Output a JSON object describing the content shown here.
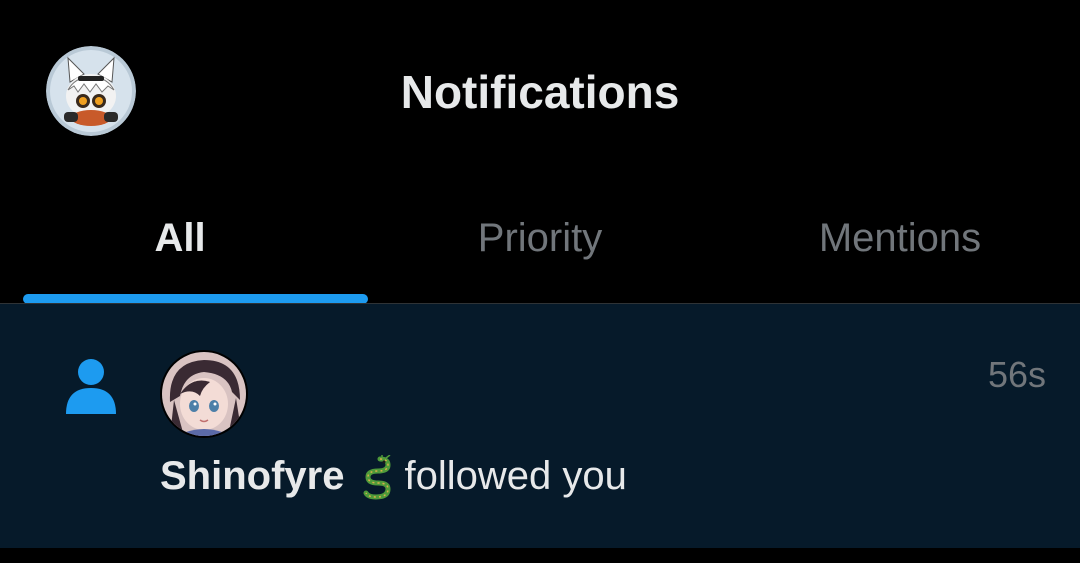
{
  "header": {
    "title": "Notifications",
    "avatar_icon": "profile-avatar-icon"
  },
  "tabs": [
    {
      "label": "All",
      "active": true
    },
    {
      "label": "Priority",
      "active": false
    },
    {
      "label": "Mentions",
      "active": false
    }
  ],
  "notification": {
    "type_icon": "person-follow-icon",
    "timestamp": "56s",
    "user_name": "Shinofyre",
    "emoji_icon": "dragon-emoji-icon",
    "action_text": "followed you"
  },
  "colors": {
    "background": "#000000",
    "accent": "#1d9bf0",
    "notification_bg": "#061a2a",
    "muted_text": "#71767b",
    "primary_text": "#e7e9ea"
  }
}
